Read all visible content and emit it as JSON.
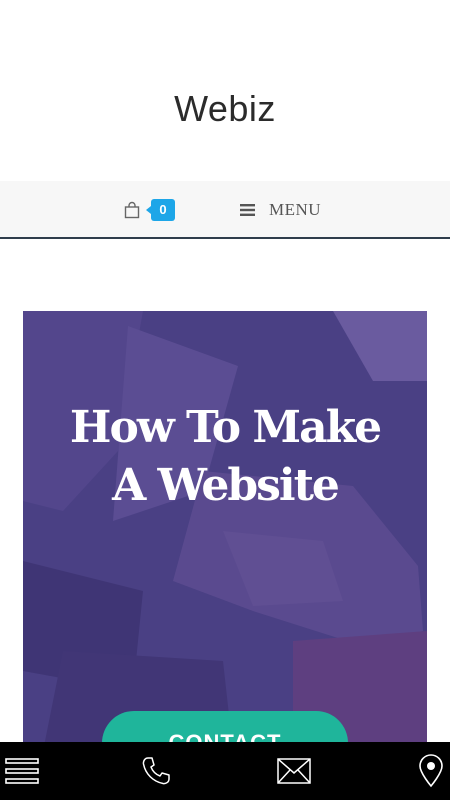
{
  "header": {
    "site_title": "Webiz"
  },
  "nav": {
    "cart_count": "0",
    "cart_icon": "shopping-bag-icon",
    "menu_icon": "hamburger-icon",
    "menu_label": "MENU",
    "accent_color": "#1da6e8",
    "border_color": "#2f3d4c"
  },
  "hero": {
    "title_line1": "How To Make",
    "title_line2": "A Website",
    "cta_label": "CONTACT",
    "overlay_color": "#4b3f86",
    "cta_color": "#1fb59b"
  },
  "bottom_bar": {
    "items": [
      {
        "icon": "menu-icon"
      },
      {
        "icon": "phone-icon"
      },
      {
        "icon": "mail-icon"
      },
      {
        "icon": "location-pin-icon"
      }
    ]
  }
}
